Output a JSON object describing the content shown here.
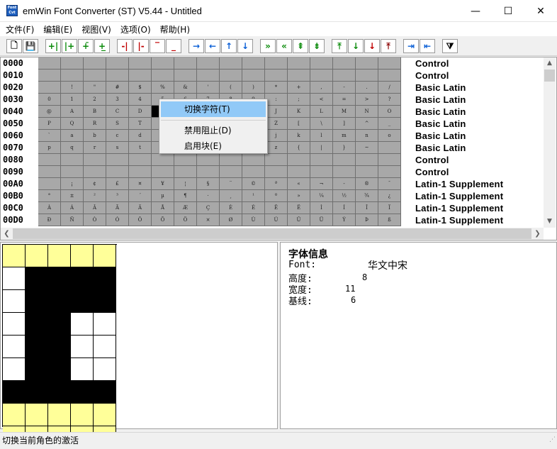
{
  "window": {
    "title": "emWin Font Converter (ST) V5.44 - Untitled",
    "icon_text": "Font Cvt",
    "controls": {
      "minimize": "—",
      "maximize": "☐",
      "close": "✕"
    }
  },
  "menu": [
    "文件(F)",
    "编辑(E)",
    "视图(V)",
    "选项(O)",
    "帮助(H)"
  ],
  "toolbar": {
    "buttons": [
      {
        "name": "new-file",
        "glyph": "🗋",
        "color": "black"
      },
      {
        "name": "save",
        "glyph": "💾",
        "color": "black"
      },
      {
        "name": "add-col-left",
        "glyph": "+|",
        "color": "green"
      },
      {
        "name": "add-col-right",
        "glyph": "|+",
        "color": "green"
      },
      {
        "name": "add-row-top",
        "glyph": "+̄",
        "color": "green"
      },
      {
        "name": "add-row-bottom",
        "glyph": "+̲",
        "color": "green"
      },
      {
        "name": "del-col-left",
        "glyph": "-|",
        "color": "red"
      },
      {
        "name": "del-col-right",
        "glyph": "|-",
        "color": "red"
      },
      {
        "name": "del-row-top",
        "glyph": "‾",
        "color": "red"
      },
      {
        "name": "del-row-bottom",
        "glyph": "_",
        "color": "red"
      },
      {
        "name": "move-right",
        "glyph": "→",
        "color": "blue"
      },
      {
        "name": "move-left",
        "glyph": "←",
        "color": "blue"
      },
      {
        "name": "move-up",
        "glyph": "↑",
        "color": "blue"
      },
      {
        "name": "move-down",
        "glyph": "↓",
        "color": "blue"
      },
      {
        "name": "fast-forward",
        "glyph": "»",
        "color": "green"
      },
      {
        "name": "fast-back",
        "glyph": "«",
        "color": "green"
      },
      {
        "name": "fast-up",
        "glyph": "⇞",
        "color": "green"
      },
      {
        "name": "fast-down",
        "glyph": "⇟",
        "color": "green"
      },
      {
        "name": "top",
        "glyph": "⤒",
        "color": "green"
      },
      {
        "name": "down",
        "glyph": "↓",
        "color": "green"
      },
      {
        "name": "down-red",
        "glyph": "↓",
        "color": "red"
      },
      {
        "name": "up-red",
        "glyph": "⤒",
        "color": "dred"
      },
      {
        "name": "to-end",
        "glyph": "⇥",
        "color": "blue"
      },
      {
        "name": "to-start",
        "glyph": "⇤",
        "color": "blue"
      },
      {
        "name": "filter",
        "glyph": "⧩",
        "color": "black"
      }
    ]
  },
  "grid": {
    "row_labels": [
      "0000",
      "0010",
      "0020",
      "0030",
      "0040",
      "0050",
      "0060",
      "0070",
      "0080",
      "0090",
      "00A0",
      "00B0",
      "00C0",
      "00D0"
    ],
    "range_names": [
      "Control",
      "Control",
      "Basic Latin",
      "Basic Latin",
      "Basic Latin",
      "Basic Latin",
      "Basic Latin",
      "Basic Latin",
      "Control",
      "Control",
      "Latin-1 Supplement",
      "Latin-1 Supplement",
      "Latin-1 Supplement",
      "Latin-1 Supplement"
    ],
    "rows": [
      [
        "",
        "",
        "",
        "",
        "",
        "",
        "",
        "",
        "",
        "",
        "",
        "",
        "",
        "",
        "",
        ""
      ],
      [
        "",
        "",
        "",
        "",
        "",
        "",
        "",
        "",
        "",
        "",
        "",
        "",
        "",
        "",
        "",
        ""
      ],
      [
        "",
        "!",
        "\"",
        "#",
        "$",
        "%",
        "&",
        "'",
        "(",
        ")",
        "*",
        "+",
        ",",
        "-",
        ".",
        "/"
      ],
      [
        "0",
        "1",
        "2",
        "3",
        "4",
        "5",
        "6",
        "7",
        "8",
        "9",
        ":",
        ";",
        "<",
        "=",
        ">",
        "?"
      ],
      [
        "@",
        "A",
        "B",
        "C",
        "D",
        "",
        "",
        "",
        "",
        "",
        "J",
        "K",
        "L",
        "M",
        "N",
        "O"
      ],
      [
        "P",
        "Q",
        "R",
        "S",
        "T",
        "",
        "",
        "",
        "",
        "",
        "Z",
        "[",
        "\\",
        "]",
        "^",
        "_"
      ],
      [
        "`",
        "a",
        "b",
        "c",
        "d",
        "",
        "",
        "",
        "",
        "",
        "j",
        "k",
        "l",
        "m",
        "n",
        "o"
      ],
      [
        "p",
        "q",
        "r",
        "s",
        "t",
        "",
        "",
        "",
        "",
        "",
        "z",
        "{",
        "|",
        "}",
        "~",
        ""
      ],
      [
        "",
        "",
        "",
        "",
        "",
        "",
        "",
        "",
        "",
        "",
        "",
        "",
        "",
        "",
        "",
        ""
      ],
      [
        "",
        "",
        "",
        "",
        "",
        "",
        "",
        "",
        "",
        "",
        "",
        "",
        "",
        "",
        "",
        ""
      ],
      [
        "",
        "¡",
        "¢",
        "£",
        "¤",
        "¥",
        "¦",
        "§",
        "¨",
        "©",
        "ª",
        "«",
        "¬",
        "-",
        "®",
        "¯"
      ],
      [
        "°",
        "±",
        "²",
        "³",
        "´",
        "µ",
        "¶",
        "·",
        "¸",
        "¹",
        "º",
        "»",
        "¼",
        "½",
        "¾",
        "¿"
      ],
      [
        "À",
        "Á",
        "Â",
        "Ã",
        "Ä",
        "Å",
        "Æ",
        "Ç",
        "È",
        "É",
        "Ê",
        "Ë",
        "Ì",
        "Í",
        "Î",
        "Ï"
      ],
      [
        "Ð",
        "Ñ",
        "Ò",
        "Ó",
        "Ô",
        "Õ",
        "Ö",
        "×",
        "Ø",
        "Ù",
        "Ú",
        "Û",
        "Ü",
        "Ý",
        "Þ",
        "ß"
      ]
    ],
    "selected": {
      "row": 4,
      "col": 5
    }
  },
  "context_menu": {
    "items": [
      {
        "label": "切换字符(T)",
        "highlighted": true
      },
      {
        "label": "禁用阻止(D)",
        "highlighted": false
      },
      {
        "label": "启用块(E)",
        "highlighted": false
      }
    ]
  },
  "bitmap": {
    "rows": [
      "yyyyy",
      "wbbbb",
      "wbbbb",
      "wbbww",
      "wbbww",
      "wbbww",
      "bbbbb",
      "yyyyy",
      "yyyyy"
    ]
  },
  "font_info": {
    "title": "字体信息",
    "font_label": "Font:",
    "font_value": "华文中宋",
    "height_label": "高度:",
    "height_value": "8",
    "width_label": "宽度:",
    "width_value": "11",
    "baseline_label": "基线:",
    "baseline_value": "6"
  },
  "status": {
    "text": "切换当前角色的激活"
  }
}
